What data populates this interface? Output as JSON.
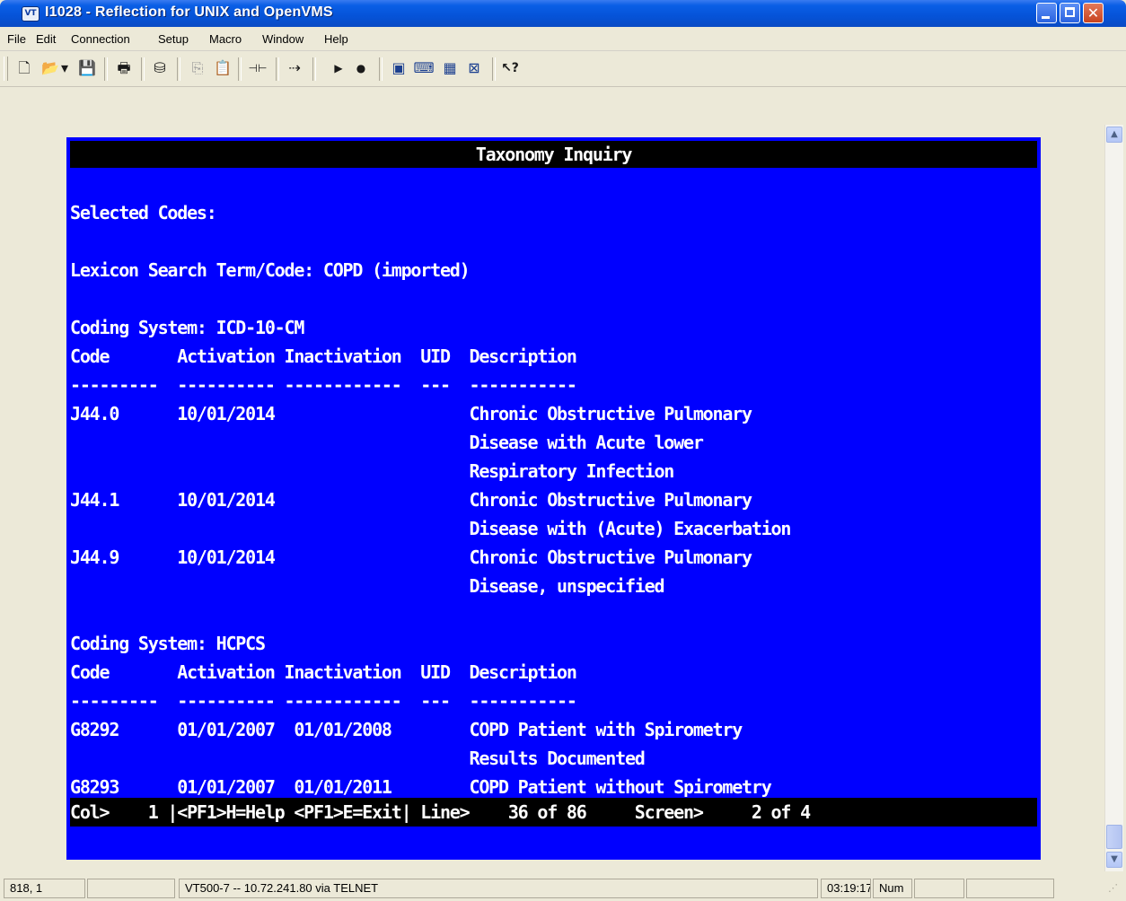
{
  "window": {
    "icon_label": "VT",
    "title": "I1028 - Reflection for UNIX and OpenVMS",
    "close_glyph": "✕"
  },
  "menu": [
    {
      "label": "File"
    },
    {
      "label": "Edit"
    },
    {
      "label": "Connection"
    },
    {
      "label": "Setup"
    },
    {
      "label": "Macro"
    },
    {
      "label": "Window"
    },
    {
      "label": "Help"
    }
  ],
  "toolbar": {
    "icons": [
      {
        "name": "new-document-icon",
        "glyph": "🗋"
      },
      {
        "name": "open-folder-icon",
        "glyph": "📂"
      },
      {
        "name": "dropdown-arrow-icon",
        "glyph": "▾"
      },
      {
        "name": "save-icon",
        "glyph": "💾"
      },
      {
        "name": "print-icon",
        "glyph": "🖶"
      },
      {
        "name": "find-binoculars-icon",
        "glyph": "⛁"
      },
      {
        "name": "copy-icon",
        "glyph": "⎘"
      },
      {
        "name": "paste-icon",
        "glyph": "📋"
      },
      {
        "name": "connect-plug-icon",
        "glyph": "⊣⊢"
      },
      {
        "name": "session-settings-icon",
        "glyph": "⇢"
      },
      {
        "name": "play-macro-icon",
        "glyph": "▶"
      },
      {
        "name": "record-macro-icon",
        "glyph": "●"
      },
      {
        "name": "display-setup-icon",
        "glyph": "▣"
      },
      {
        "name": "keyboard-map-icon",
        "glyph": "⌨"
      },
      {
        "name": "mouse-map-icon",
        "glyph": "▦"
      },
      {
        "name": "window-layout-icon",
        "glyph": "⊠"
      },
      {
        "name": "context-help-icon",
        "glyph": "↖?"
      }
    ]
  },
  "terminal": {
    "header": "Taxonomy Inquiry",
    "lines": [
      "",
      "Selected Codes:",
      "",
      "Lexicon Search Term/Code: COPD (imported)",
      "",
      "Coding System: ICD-10-CM",
      "Code       Activation Inactivation  UID  Description",
      "---------  ---------- ------------  ---  -----------",
      "J44.0      10/01/2014                    Chronic Obstructive Pulmonary",
      "                                         Disease with Acute lower",
      "                                         Respiratory Infection",
      "J44.1      10/01/2014                    Chronic Obstructive Pulmonary",
      "                                         Disease with (Acute) Exacerbation",
      "J44.9      10/01/2014                    Chronic Obstructive Pulmonary",
      "                                         Disease, unspecified",
      "",
      "Coding System: HCPCS",
      "Code       Activation Inactivation  UID  Description",
      "---------  ---------- ------------  ---  -----------",
      "G8292      01/01/2007  01/01/2008        COPD Patient with Spirometry",
      "                                         Results Documented",
      "G8293      01/01/2007  01/01/2011        COPD Patient without Spirometry"
    ],
    "status_line": "Col>    1 |<PF1>H=Help <PF1>E=Exit| Line>    36 of 86     Screen>     2 of 4"
  },
  "statusbar": {
    "cursor_position": "818, 1",
    "empty1": "",
    "connection": "VT500-7 -- 10.72.241.80 via TELNET",
    "time": "03:19:17",
    "num_lock": "Num",
    "empty2": "",
    "empty3": ""
  },
  "colors": {
    "terminal_background": "#0000ff",
    "terminal_text": "#ffffff",
    "header_background": "#000000"
  }
}
